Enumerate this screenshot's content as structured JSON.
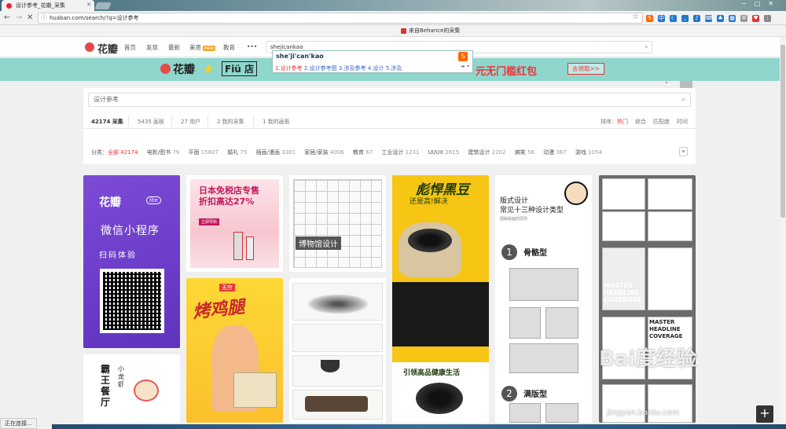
{
  "browser": {
    "tab_title": "设计参考_花瓣_采集",
    "url": "huaban.com/search/?q=设计参考",
    "bookmark": "来自Behance的采集",
    "status": "正在连接..."
  },
  "site": {
    "logo": "花瓣",
    "nav": [
      "首页",
      "发现",
      "最新",
      "美思",
      "教育"
    ],
    "new_badge": "new",
    "more": "•••",
    "search_value": "shejicankao"
  },
  "ime": {
    "composition": "she'ji'can'kao",
    "candidates": [
      "1.设计参考",
      "2.设计参考图",
      "3.涉及参考",
      "4.设计",
      "5.涉及"
    ]
  },
  "banner": {
    "logo": "花瓣",
    "brand": "Fiü 店",
    "text": "元无门槛红包",
    "button": "去领取>>"
  },
  "panel": {
    "search_placeholder": "设计参考",
    "tabs": [
      "42174 采集",
      "5435 画板",
      "27 用户",
      "2 我的采集",
      "1 我的画板"
    ],
    "sort_label": "排序：",
    "sorts": [
      "热门",
      "综合",
      "匹配度",
      "时间"
    ],
    "cat_label": "分类：",
    "categories": [
      {
        "name": "全部",
        "count": "42174"
      },
      {
        "name": "电影/图书",
        "count": "79"
      },
      {
        "name": "平面",
        "count": "15807"
      },
      {
        "name": "婚礼",
        "count": "75"
      },
      {
        "name": "插画/漫画",
        "count": "3301"
      },
      {
        "name": "家居/家装",
        "count": "4006"
      },
      {
        "name": "教育",
        "count": "67"
      },
      {
        "name": "工业设计",
        "count": "1231"
      },
      {
        "name": "UI/UX",
        "count": "2615"
      },
      {
        "name": "建筑设计",
        "count": "2202"
      },
      {
        "name": "搞笑",
        "count": "56"
      },
      {
        "name": "动漫",
        "count": "367"
      },
      {
        "name": "游戏",
        "count": "1054"
      }
    ]
  },
  "cards": {
    "c1": {
      "logo": "花瓣",
      "lite": "lite",
      "mini": "微信小程序",
      "scan": "扫码体验"
    },
    "c2": {
      "title": "日本免税店专售",
      "title2": "折扣高达27%",
      "btn": "立即导购"
    },
    "c3": {
      "label": "博物馆设计"
    },
    "c4": {
      "title": "彪悍黑豆",
      "sub": "还是高!解决",
      "bottom": "引领高品健康生活"
    },
    "c5": {
      "title": "版式设计",
      "title2": "常见十三种设计类型",
      "sub": "图解版面的原则",
      "n1": "1",
      "g1": "骨骼型",
      "n2": "2",
      "g2": "满版型"
    },
    "c6": {
      "m1": "MASTER HEADLINE COVERAGE",
      "m2": "MASTER HEADLINE COVERAGE"
    },
    "c7": {
      "v1": "霸王餐厅",
      "v2": "小龙虾"
    },
    "c8": {
      "brand": "无穷",
      "title": "烤鸡腿"
    }
  },
  "watermark": {
    "main": "Bai度经验",
    "sub": "jingyan.baidu.com"
  }
}
